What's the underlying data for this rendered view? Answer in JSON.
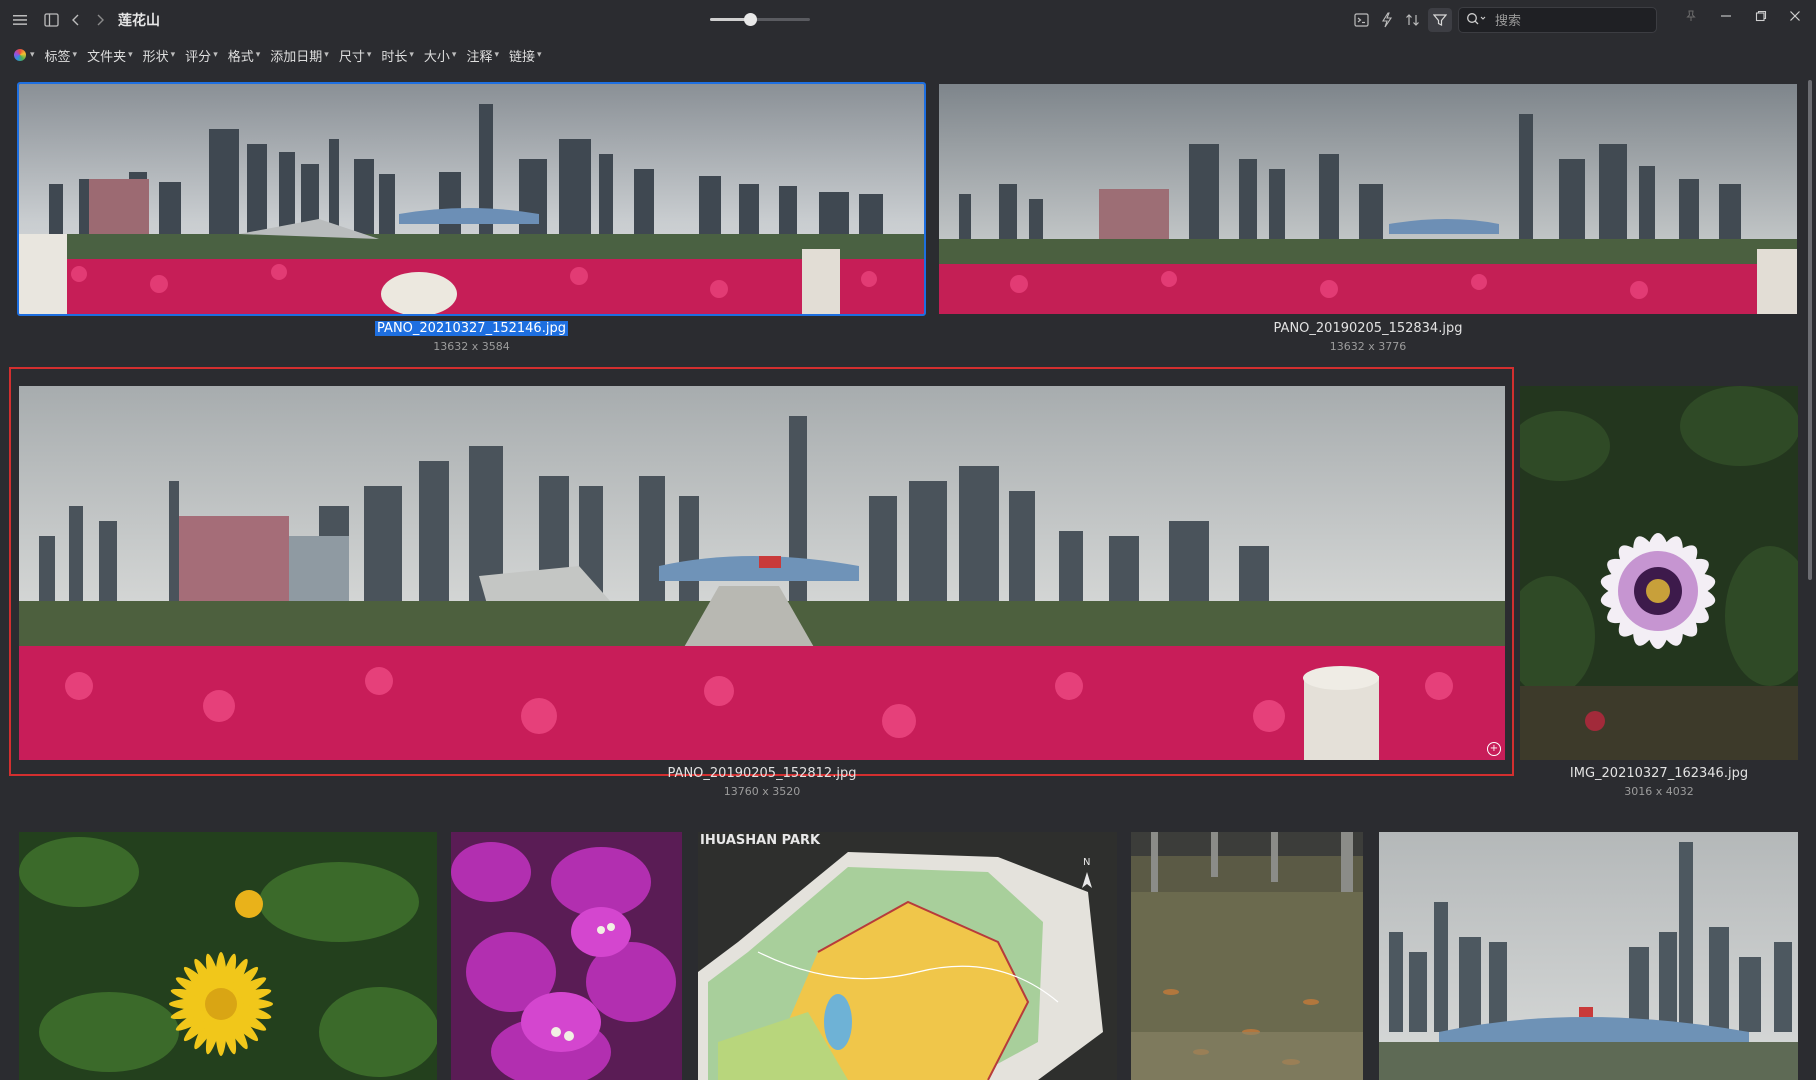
{
  "window": {
    "title": "莲花山"
  },
  "search": {
    "placeholder": "搜索"
  },
  "zoom": {
    "level": 0.4
  },
  "filters": [
    "标签",
    "文件夹",
    "形状",
    "评分",
    "格式",
    "添加日期",
    "尺寸",
    "时长",
    "大小",
    "注释",
    "链接"
  ],
  "images": [
    {
      "name": "PANO_20210327_152146.jpg",
      "dims": "13632 x 3584",
      "selected": true
    },
    {
      "name": "PANO_20190205_152834.jpg",
      "dims": "13632 x 3776"
    },
    {
      "name": "PANO_20190205_152812.jpg",
      "dims": "13760 x 3520",
      "hovered": true
    },
    {
      "name": "IMG_20210327_162346.jpg",
      "dims": "3016 x 4032"
    },
    {
      "name": "",
      "dims": ""
    },
    {
      "name": "",
      "dims": ""
    },
    {
      "name": "",
      "dims": "",
      "sign_text": "IHUASHAN PARK"
    },
    {
      "name": "",
      "dims": ""
    },
    {
      "name": "",
      "dims": ""
    }
  ],
  "colors": {
    "accent": "#1e6fe0",
    "hover_border": "#d32f2f",
    "background": "#2b2c30"
  },
  "icons": [
    "menu-icon",
    "sidebar-icon",
    "back-icon",
    "forward-icon",
    "terminal-icon",
    "lightning-icon",
    "sort-icon",
    "filter-icon",
    "search-icon",
    "pin-icon",
    "minimize-icon",
    "restore-icon",
    "close-icon",
    "palette-icon",
    "chevron-down-icon",
    "zoom-icon"
  ]
}
